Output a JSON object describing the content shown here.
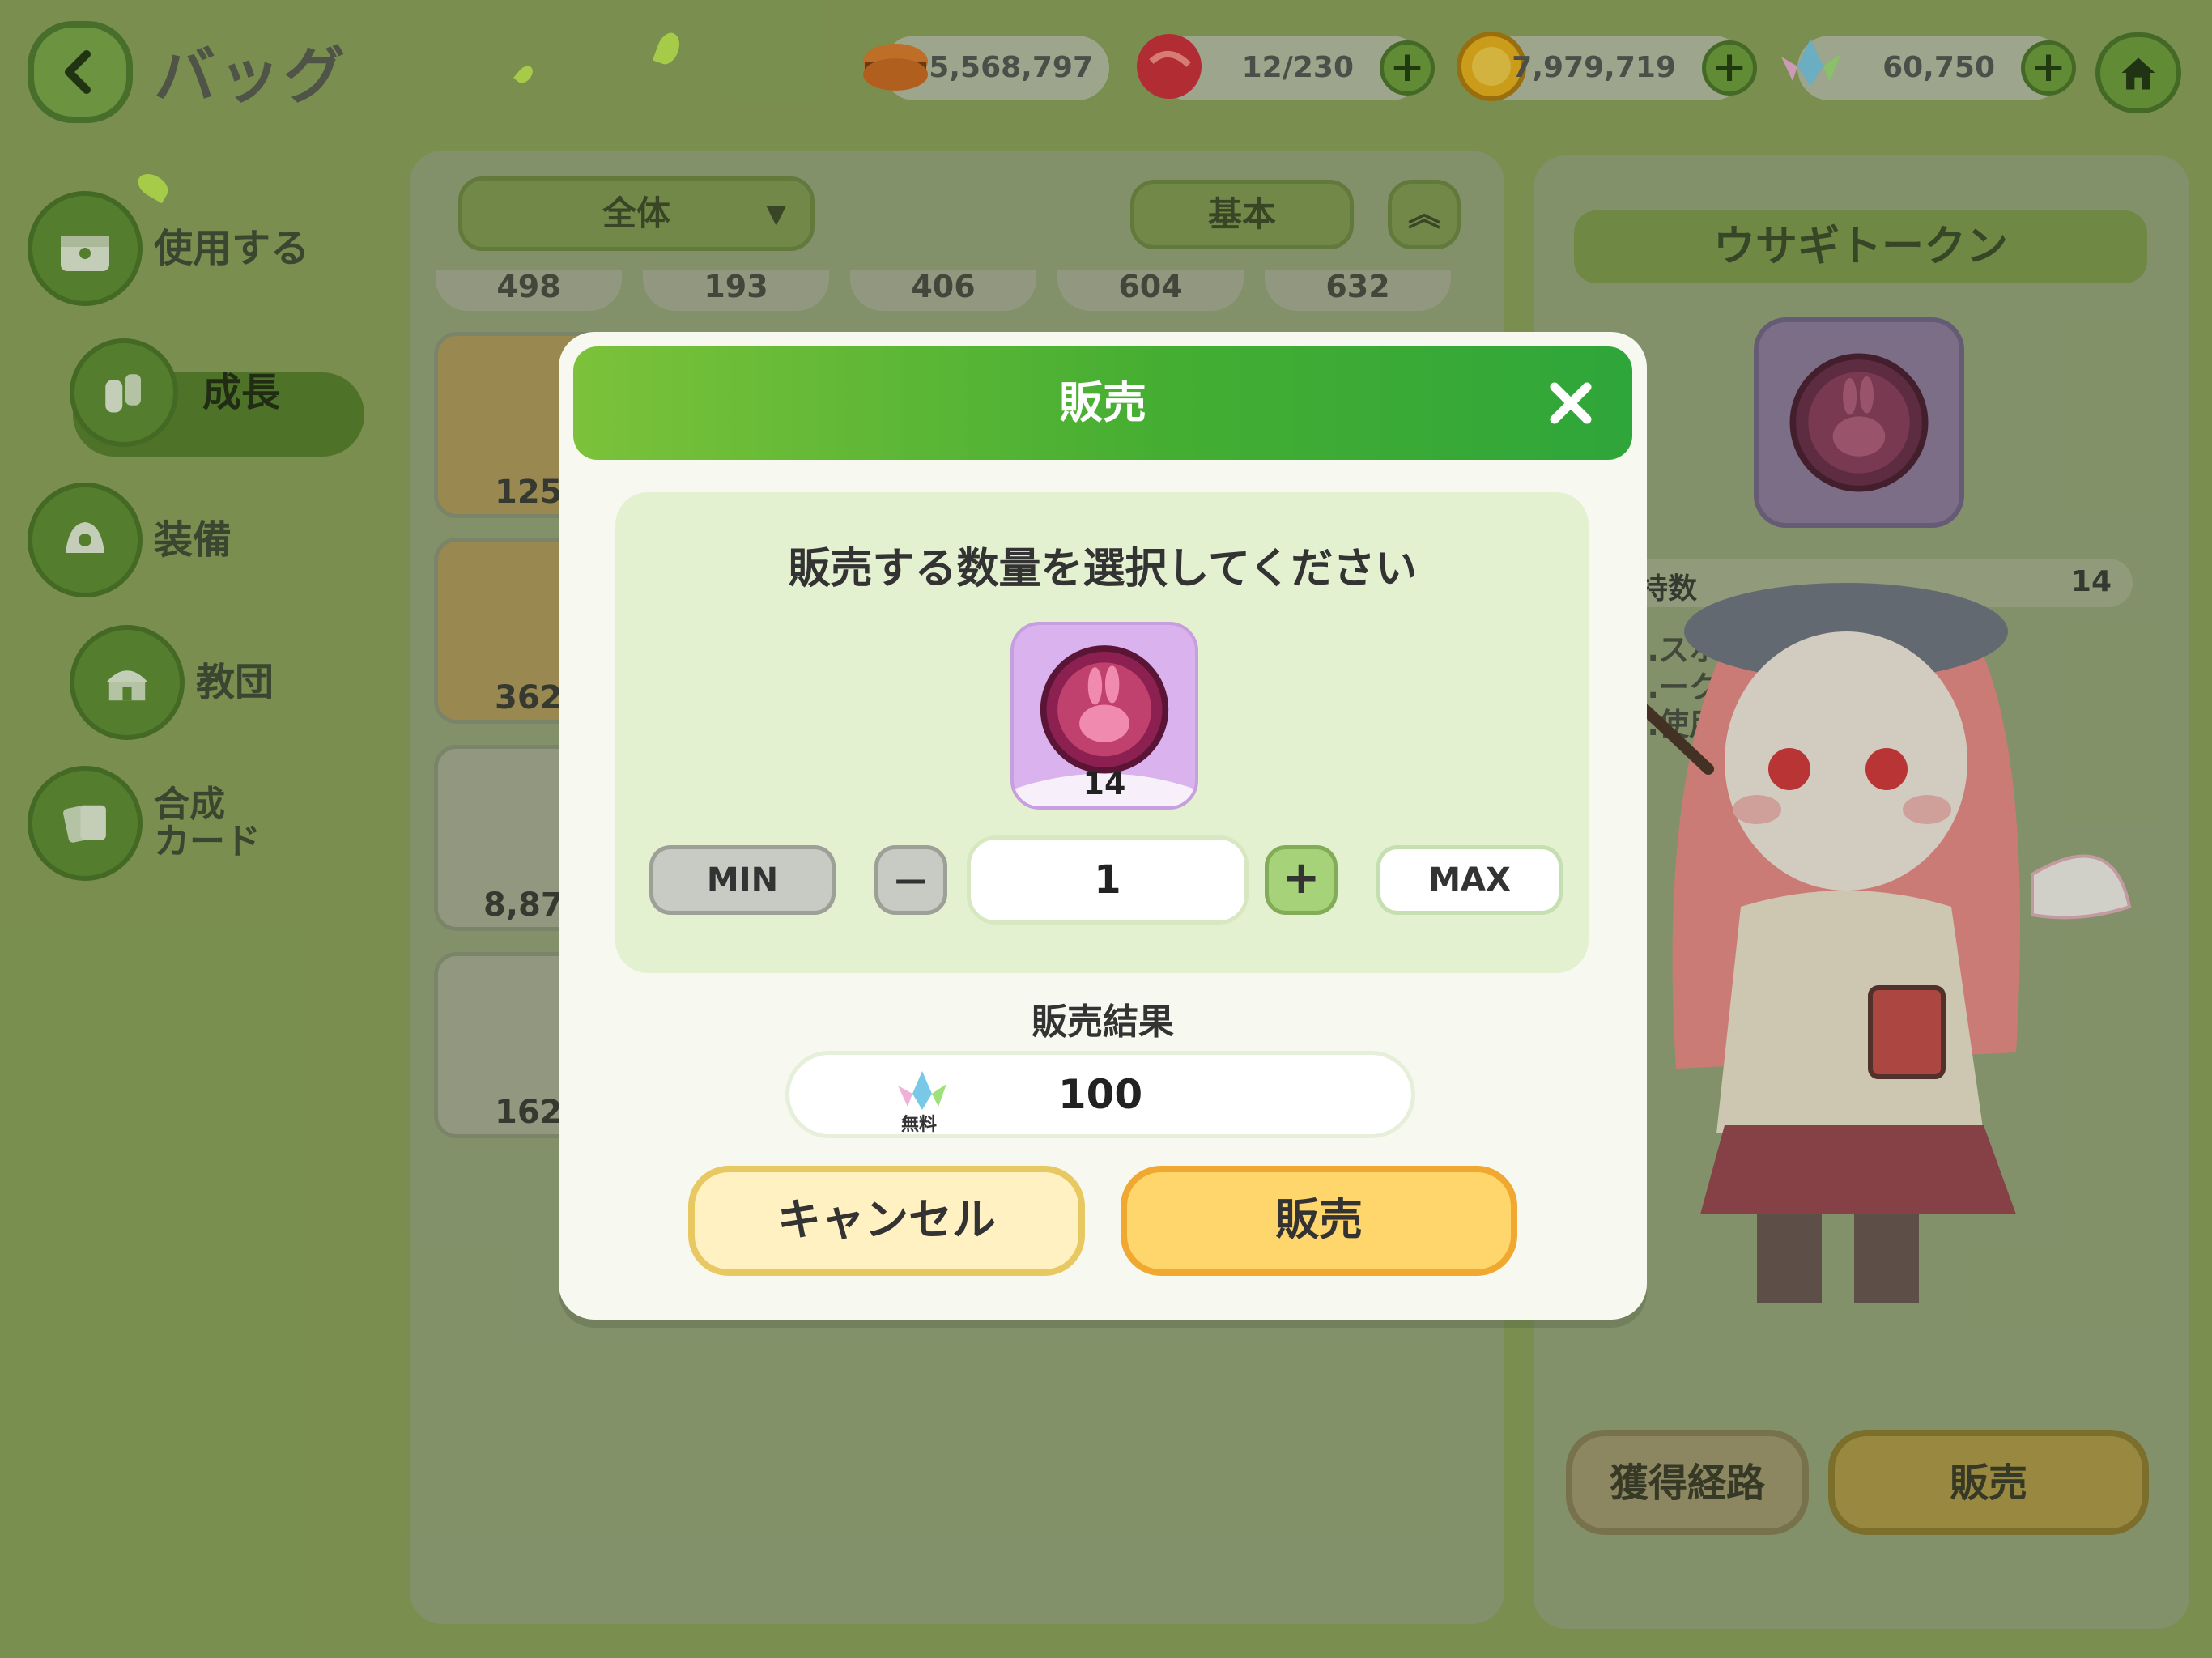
{
  "header": {
    "title": "バッグ",
    "currencies": [
      {
        "name": "cookie",
        "value": "5,568,797",
        "has_plus": false
      },
      {
        "name": "candy",
        "value": "12/230",
        "has_plus": true
      },
      {
        "name": "gold-coin",
        "value": "7,979,719",
        "has_plus": true
      },
      {
        "name": "crystal",
        "value": "60,750",
        "has_plus": true
      }
    ]
  },
  "sidebar": {
    "items": [
      {
        "label": "使用する",
        "icon": "chest-icon"
      },
      {
        "label": "成長",
        "icon": "potion-icon",
        "active": true
      },
      {
        "label": "装備",
        "icon": "costume-icon"
      },
      {
        "label": "教団",
        "icon": "temple-icon"
      },
      {
        "label": "合成\nカード",
        "icon": "card-icon"
      }
    ]
  },
  "inventory": {
    "filter_label": "全体",
    "sort_label": "基本",
    "top_counts": [
      "498",
      "193",
      "406",
      "604",
      "632"
    ],
    "side_counts": [
      "125",
      "362",
      "8,87",
      "162"
    ]
  },
  "detail": {
    "title": "ウサギトークン",
    "count_label": "持数",
    "count_value": "14",
    "description": "…スホー…れられ\n…ークン…ベント\n…使用…",
    "acquire_label": "獲得経路",
    "sell_label": "販売"
  },
  "modal": {
    "title": "販売",
    "prompt": "販売する数量を選択してください",
    "item_count": "14",
    "min_label": "MIN",
    "max_label": "MAX",
    "quantity": "1",
    "result_label": "販売結果",
    "result_value": "100",
    "free_label": "無料",
    "cancel_label": "キャンセル",
    "sell_label": "販売"
  },
  "colors": {
    "background": "#8ba25c",
    "modal_header": "#45ae32",
    "sell_button": "#ffd66b",
    "cancel_button": "#fff1c2"
  }
}
